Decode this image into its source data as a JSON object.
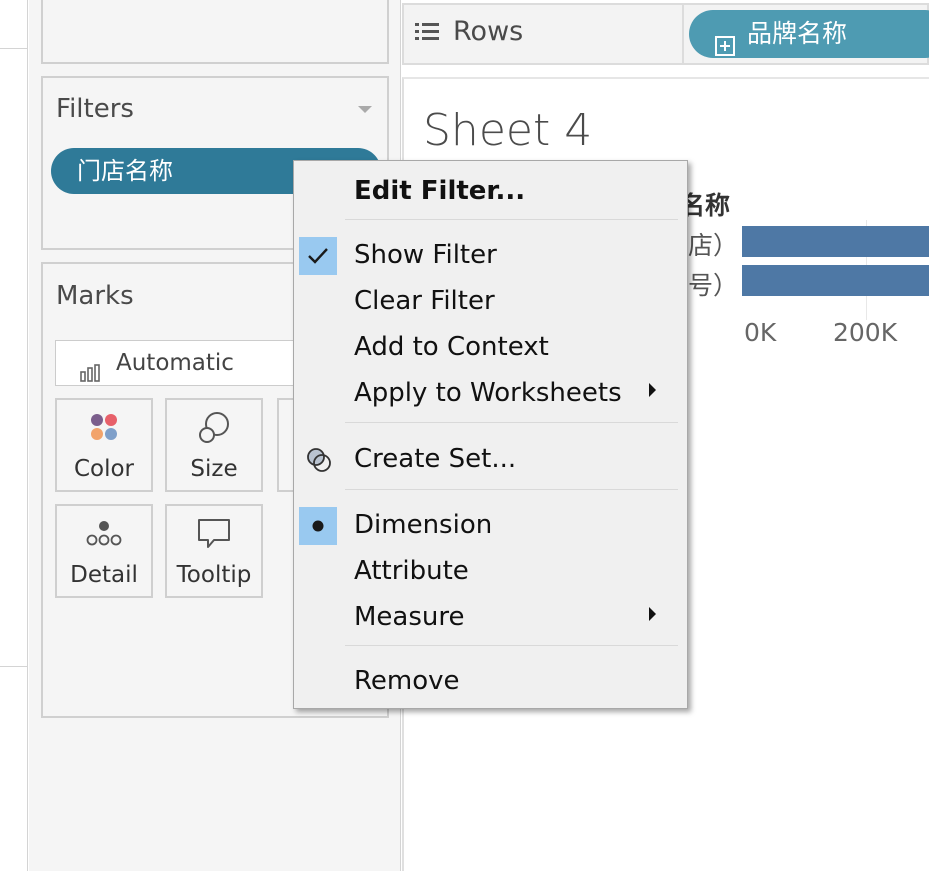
{
  "shelves": {
    "rows_label": "Rows",
    "rows_pill": "品牌名称"
  },
  "filters": {
    "title": "Filters",
    "pill": "门店名称"
  },
  "marks": {
    "title": "Marks",
    "type": "Automatic",
    "buttons": [
      {
        "label": "Color",
        "icon": "color-icon"
      },
      {
        "label": "Size",
        "icon": "size-icon"
      },
      {
        "label": "Detail",
        "icon": "detail-icon"
      },
      {
        "label": "Tooltip",
        "icon": "tooltip-icon"
      }
    ]
  },
  "sheet": {
    "title": "Sheet 4",
    "column_header_partial": "名称",
    "row_labels_partial": [
      "店）",
      "号）"
    ],
    "axis_ticks": [
      "0K",
      "200K"
    ],
    "bar_color": "#4e78a5"
  },
  "context_menu": {
    "items": [
      {
        "label": "Edit Filter...",
        "bold": true
      },
      {
        "label": "Show Filter",
        "checked": true
      },
      {
        "label": "Clear Filter"
      },
      {
        "label": "Add to Context"
      },
      {
        "label": "Apply to Worksheets",
        "submenu": true
      },
      {
        "label": "Create Set...",
        "icon": "create-set-icon"
      },
      {
        "label": "Dimension",
        "selected": true
      },
      {
        "label": "Attribute"
      },
      {
        "label": "Measure",
        "submenu": true
      },
      {
        "label": "Remove"
      }
    ]
  },
  "colors": {
    "filter_pill": "#2f7a98",
    "rows_pill": "#4e9bb2",
    "menu_highlight": "#99c9f0"
  }
}
